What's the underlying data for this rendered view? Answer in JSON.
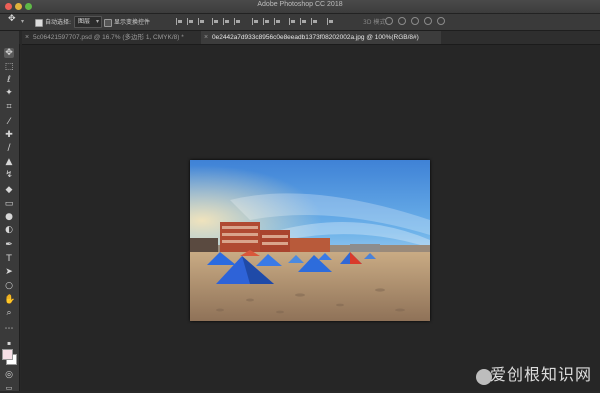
{
  "app": {
    "title": "Adobe Photoshop CC 2018"
  },
  "options_bar": {
    "auto_select_label": "自动选择:",
    "auto_select_target": "图层",
    "show_transform_label": "显示变换控件",
    "mode_3d_label": "3D 模式:"
  },
  "tabs": [
    {
      "label": "5c06421597707.psd @ 16.7% (多边形 1, CMYK/8) *",
      "active": false
    },
    {
      "label": "0e2442a7d933c8956c0e8eeadb1373f08202002a.jpg @ 100%(RGB/8#)",
      "active": true
    }
  ],
  "tools": [
    "move-tool",
    "marquee-tool",
    "lasso-tool",
    "magic-wand-tool",
    "crop-tool",
    "eyedropper-tool",
    "healing-brush-tool",
    "brush-tool",
    "clone-stamp-tool",
    "history-brush-tool",
    "eraser-tool",
    "gradient-tool",
    "blur-tool",
    "dodge-tool",
    "pen-tool",
    "type-tool",
    "path-selection-tool",
    "rectangle-tool",
    "hand-tool",
    "zoom-tool",
    "more-tools"
  ],
  "colors": {
    "foreground": "#f6dfe6",
    "background": "#ffffff",
    "tent_blue": "#2e63d8",
    "sky_top": "#3f82d6"
  },
  "watermark": {
    "text": "爱创根知识网"
  }
}
